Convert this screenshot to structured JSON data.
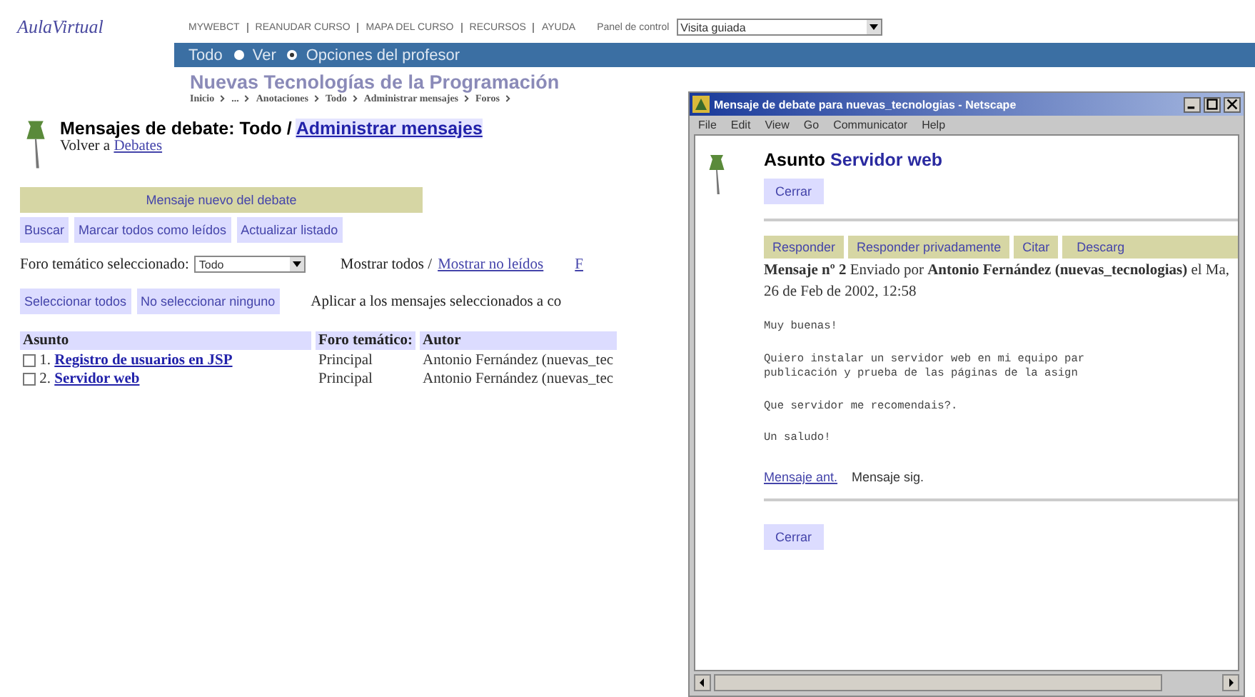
{
  "logo": "AulaVirtual",
  "nav": [
    "MYWEBCT",
    "REANUDAR CURSO",
    "MAPA DEL CURSO",
    "RECURSOS",
    "AYUDA"
  ],
  "control_panel": {
    "label": "Panel de control",
    "value": "Visita guiada"
  },
  "view_bar": {
    "label": "Todo",
    "options": [
      {
        "label": "Ver",
        "selected": false
      },
      {
        "label": "Opciones del profesor",
        "selected": true
      }
    ]
  },
  "course_title": "Nuevas Tecnologías de la Programación",
  "breadcrumb": [
    "Inicio",
    "...",
    "Anotaciones",
    "Todo",
    "Administrar mensajes",
    "Foros"
  ],
  "heading": {
    "text": "Mensajes de debate: Todo /",
    "link": "Administrar mensajes"
  },
  "back": {
    "text": "Volver a",
    "link": "Debates"
  },
  "new_message": "Mensaje nuevo del debate",
  "actions": [
    "Buscar",
    "Marcar todos como leídos",
    "Actualizar listado"
  ],
  "filter": {
    "label": "Foro temático seleccionado:",
    "value": "Todo",
    "show_all": "Mostrar todos /",
    "show_unread": "Mostrar no leídos",
    "cut": "F"
  },
  "select_buttons": [
    "Seleccionar todos",
    "No seleccionar ninguno"
  ],
  "apply_text": "Aplicar a los mensajes seleccionados a co",
  "table": {
    "columns": [
      "Asunto",
      "Foro temático:",
      "Autor"
    ],
    "rows": [
      {
        "checked": false,
        "num": "1.",
        "subject": "Registro de usuarios en JSP",
        "forum": "Principal",
        "author": "Antonio Fernández (nuevas_tec"
      },
      {
        "checked": false,
        "num": "2.",
        "subject": "Servidor web",
        "forum": "Principal",
        "author": "Antonio Fernández (nuevas_tec"
      }
    ]
  },
  "popup": {
    "title": "Mensaje de debate para nuevas_tecnologias - Netscape",
    "menu": [
      "File",
      "Edit",
      "View",
      "Go",
      "Communicator",
      "Help"
    ],
    "subject_label": "Asunto",
    "subject": "Servidor web",
    "close": "Cerrar",
    "actions": [
      "Responder",
      "Responder privadamente",
      "Citar",
      "Descarg"
    ],
    "meta": "**Mensaje nº 2** Enviado por **Antonio Fernández (nuevas_tecnologias)** el Ma, 26 de Feb de 2002, 12:58",
    "body": [
      "Muy buenas!",
      "Quiero instalar un servidor web en mi equipo par\npublicación y prueba de las páginas de la asign",
      "Que servidor me recomendais?.",
      "Un saludo!"
    ],
    "prev": "Mensaje ant.",
    "next": "Mensaje sig.",
    "close_bottom": "Cerrar"
  }
}
